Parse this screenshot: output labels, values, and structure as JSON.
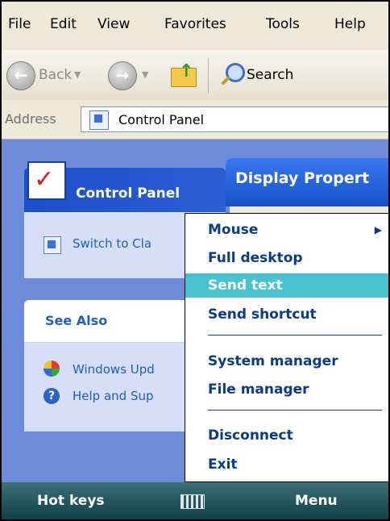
{
  "menubar": {
    "items": [
      "File",
      "Edit",
      "View",
      "Favorites",
      "Tools",
      "Help"
    ]
  },
  "toolbar": {
    "back_label": "Back",
    "search_label": "Search"
  },
  "address": {
    "label": "Address",
    "value": "Control Panel"
  },
  "task_pane": {
    "title": "Control Panel",
    "switch_link": "Switch to Cla",
    "see_also_title": "See Also",
    "see_also_links": [
      "Windows Upd",
      "Help and Sup"
    ]
  },
  "display_window": {
    "title": "Display Propert"
  },
  "context_menu": {
    "items": [
      {
        "label": "Mouse",
        "submenu": true
      },
      {
        "label": "Full desktop"
      },
      {
        "label": "Send text",
        "selected": true
      },
      {
        "label": "Send shortcut"
      },
      {
        "label": "System manager"
      },
      {
        "label": "File manager"
      },
      {
        "label": "Disconnect"
      },
      {
        "label": "Exit"
      }
    ]
  },
  "softkeys": {
    "left": "Hot keys",
    "right": "Menu"
  },
  "colors": {
    "selection": "#48c2cf",
    "menu_text": "#0c3a8a",
    "task_pane_blue": "#6d8bd8"
  }
}
